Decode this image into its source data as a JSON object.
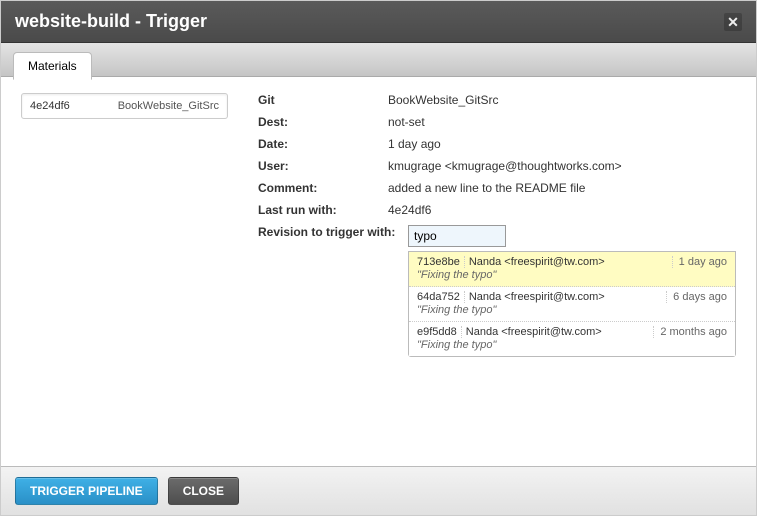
{
  "dialog": {
    "title": "website-build - Trigger",
    "tab_materials": "Materials"
  },
  "materials": [
    {
      "rev": "4e24df6",
      "name": "BookWebsite_GitSrc"
    }
  ],
  "labels": {
    "git": "Git",
    "dest": "Dest:",
    "date": "Date:",
    "user": "User:",
    "comment": "Comment:",
    "last_run": "Last run with:",
    "revision_to_trigger": "Revision to trigger with:"
  },
  "details": {
    "git": "BookWebsite_GitSrc",
    "dest": "not-set",
    "date": "1 day ago",
    "user": "kmugrage <kmugrage@thoughtworks.com>",
    "comment": "added a new line to the README file",
    "last_run": "4e24df6",
    "revision_input": "typo"
  },
  "autocomplete": [
    {
      "hash": "713e8be",
      "author": "Nanda <freespirit@tw.com>",
      "message": "\"Fixing the typo\"",
      "time": "1 day ago",
      "selected": true
    },
    {
      "hash": "64da752",
      "author": "Nanda <freespirit@tw.com>",
      "message": "\"Fixing the typo\"",
      "time": "6 days ago",
      "selected": false
    },
    {
      "hash": "e9f5dd8",
      "author": "Nanda <freespirit@tw.com>",
      "message": "\"Fixing the typo\"",
      "time": "2 months ago",
      "selected": false
    }
  ],
  "buttons": {
    "trigger": "TRIGGER PIPELINE",
    "close": "CLOSE"
  }
}
